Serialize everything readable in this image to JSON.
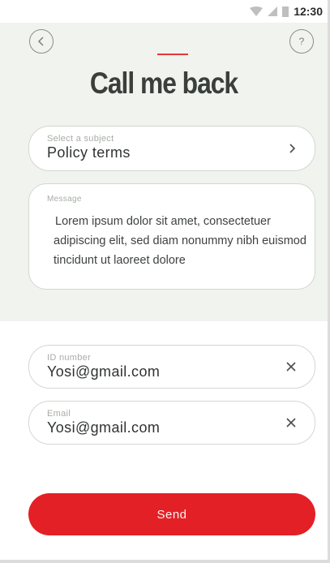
{
  "status_bar": {
    "time": "12:30"
  },
  "header": {
    "back_icon": "back-chevron-icon",
    "help_label": "?",
    "title": "Call me back"
  },
  "subject_select": {
    "label": "Select a subject",
    "value": "Policy terms",
    "icon": "chevron-right-icon"
  },
  "message": {
    "label": "Message",
    "value": "Lorem ipsum dolor sit amet, consectetuer adipiscing elit, sed diam nonummy nibh euismod tincidunt ut laoreet dolore"
  },
  "id_field": {
    "label": "ID number",
    "value": "Yosi@gmail.com",
    "clear_icon": "close-icon"
  },
  "email_field": {
    "label": "Email",
    "value": "Yosi@gmail.com",
    "clear_icon": "close-icon"
  },
  "send_button": {
    "label": "Send"
  },
  "colors": {
    "accent": "#e32025",
    "header_bg": "#f0f3ee",
    "title": "#3b3f3b"
  }
}
